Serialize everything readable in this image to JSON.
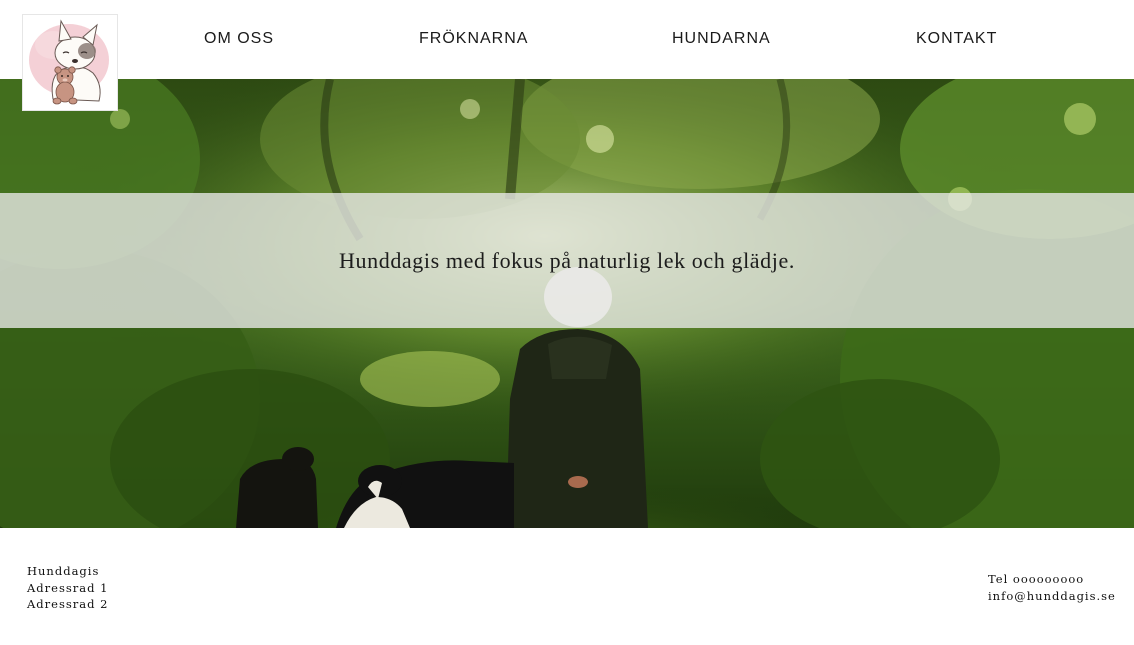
{
  "header": {
    "logo_icon": "puppy-with-teddy-bear-icon",
    "nav": [
      {
        "label": "OM OSS"
      },
      {
        "label": "FRÖKNARNA"
      },
      {
        "label": "HUNDARNA"
      },
      {
        "label": "KONTAKT"
      }
    ]
  },
  "hero": {
    "tagline": "Hunddagis med fokus på naturlig lek och glädje."
  },
  "footer": {
    "name": "Hunddagis",
    "address_line_1": "Adressrad 1",
    "address_line_2": "Adressrad 2",
    "phone": "Tel ooooooooo",
    "email": "info@hunddagis.se"
  },
  "colors": {
    "accent_pink": "#f2c8cf",
    "foliage_green": "#3f6b1e"
  }
}
